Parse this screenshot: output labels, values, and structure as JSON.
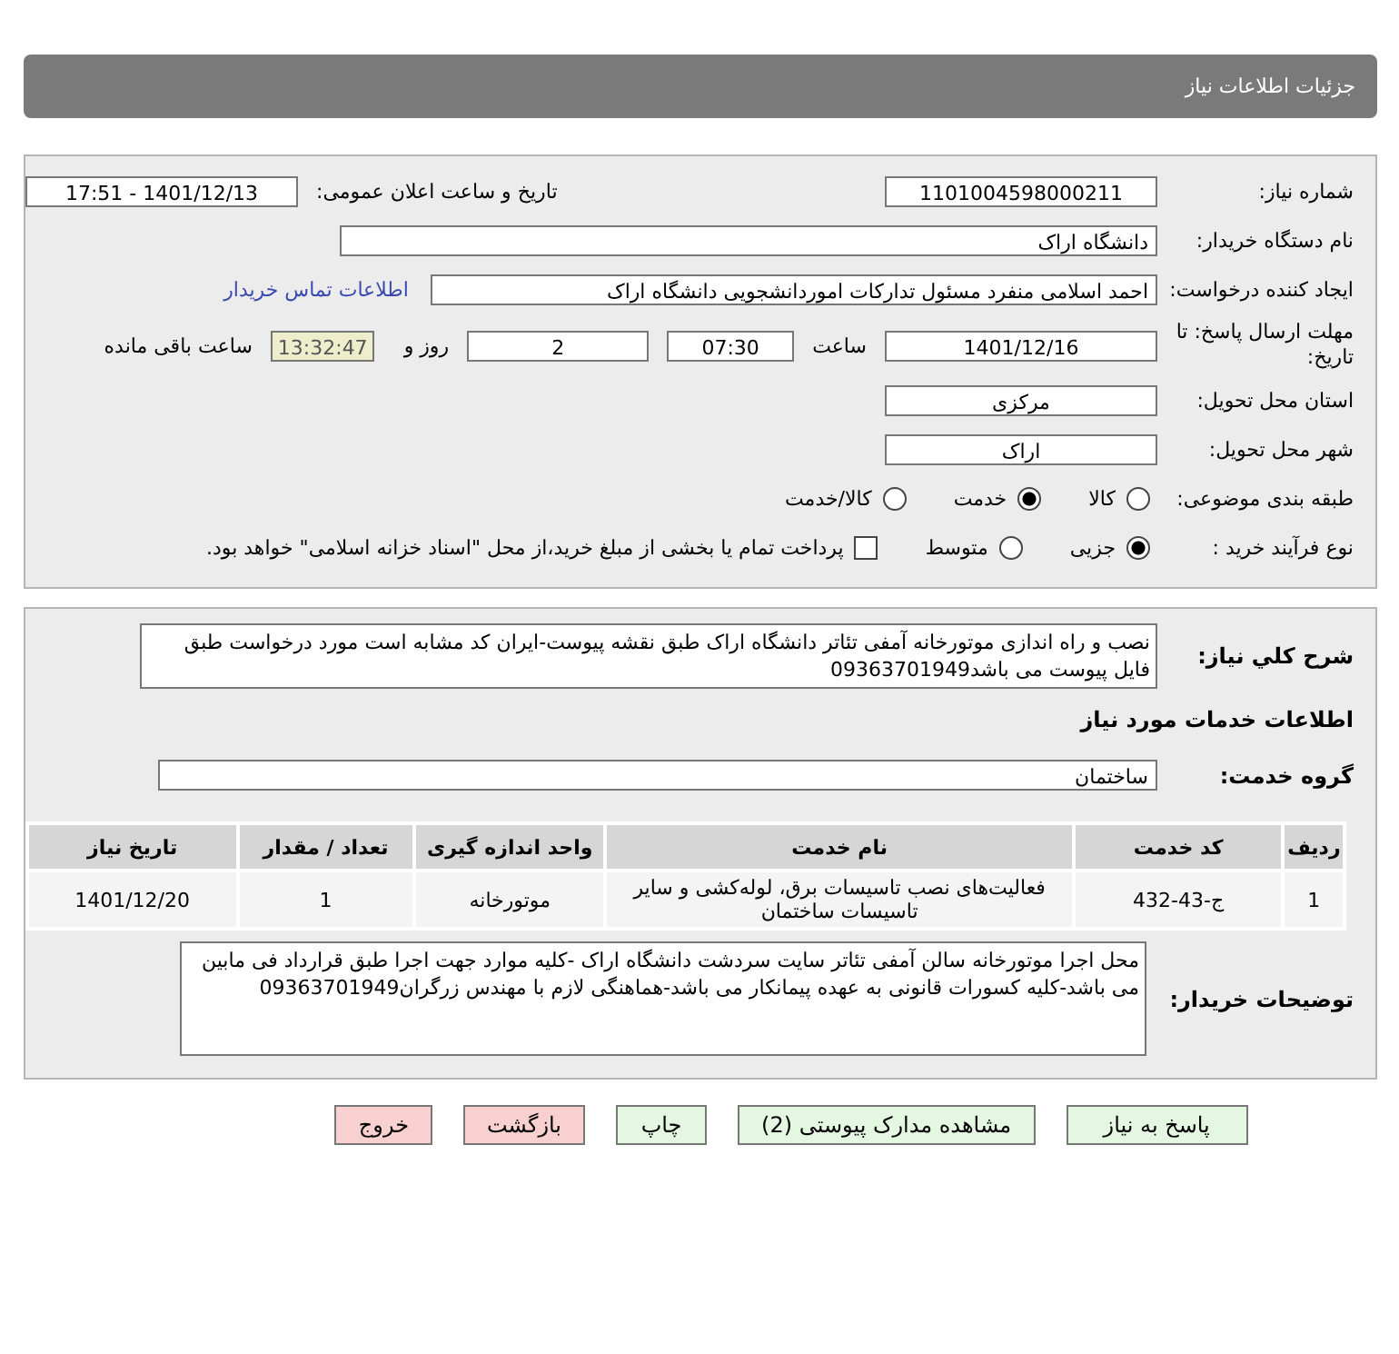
{
  "header": {
    "title": "جزئیات اطلاعات نیاز"
  },
  "need_info": {
    "need_number": {
      "label": "شماره نیاز:",
      "value": "1101004598000211"
    },
    "announce": {
      "label": "تاریخ و ساعت اعلان عمومی:",
      "value": "1401/12/13 - 17:51"
    },
    "buyer": {
      "label": "نام دستگاه خریدار:",
      "value": "دانشگاه اراک"
    },
    "requester": {
      "label": "ایجاد کننده درخواست:",
      "value": "احمد  اسلامی منفرد مسئول تدارکات اموردانشجویی دانشگاه اراک",
      "link": "اطلاعات تماس خریدار"
    },
    "deadline": {
      "label": "مهلت ارسال پاسخ: تا تاریخ:",
      "date": "1401/12/16",
      "time_label": "ساعت",
      "time": "07:30",
      "days": "2",
      "days_label": "روز و",
      "remaining": "13:32:47",
      "remaining_label": "ساعت باقی مانده"
    },
    "province": {
      "label": "استان محل تحویل:",
      "value": "مرکزی"
    },
    "city": {
      "label": "شهر محل تحویل:",
      "value": "اراک"
    },
    "category": {
      "label": "طبقه بندی موضوعی:",
      "options": [
        {
          "label": "کالا",
          "selected": false
        },
        {
          "label": "خدمت",
          "selected": true
        },
        {
          "label": "کالا/خدمت",
          "selected": false
        }
      ]
    },
    "process": {
      "label": "نوع فرآیند خرید :",
      "options": [
        {
          "label": "جزیی",
          "selected": true
        },
        {
          "label": "متوسط",
          "selected": false
        }
      ],
      "payment": {
        "checked": false,
        "text": "پرداخت تمام یا بخشی از مبلغ خرید،از محل \"اسناد خزانه اسلامی\" خواهد بود."
      }
    }
  },
  "details": {
    "summary": {
      "label": "شرح کلي نياز:",
      "value": "نصب و راه اندازی موتورخانه آمفی تئاتر دانشگاه اراک طبق نقشه پیوست-ایران کد مشابه است مورد درخواست طبق فایل پیوست می باشد09363701949"
    },
    "services_heading": "اطلاعات خدمات مورد نیاز",
    "service_group": {
      "label": "گروه خدمت:",
      "value": "ساختمان"
    },
    "table": {
      "columns": [
        "ردیف",
        "کد خدمت",
        "نام خدمت",
        "واحد اندازه گیری",
        "تعداد / مقدار",
        "تاریخ نیاز"
      ],
      "rows": [
        [
          "1",
          "ج-43-432",
          "فعالیت‌های نصب تاسیسات برق، لوله‌کشی و سایر تاسیسات ساختمان",
          "موتورخانه",
          "1",
          "1401/12/20"
        ]
      ]
    },
    "buyer_notes": {
      "label": "توضیحات خریدار:",
      "value": "محل اجرا موتورخانه سالن آمفی تئاتر سایت سردشت دانشگاه اراک -کلیه موارد جهت اجرا طبق قرارداد فی مابین می باشد-کلیه کسورات قانونی به عهده پیمانکار می باشد-هماهنگی لازم با مهندس زرگران09363701949"
    }
  },
  "buttons": [
    {
      "label": "پاسخ به نیاز",
      "kind": "green"
    },
    {
      "label": "مشاهده مدارک پیوستی (2)",
      "kind": "green"
    },
    {
      "label": "چاپ",
      "kind": "green"
    },
    {
      "label": "بازگشت",
      "kind": "pink"
    },
    {
      "label": "خروج",
      "kind": "pink"
    }
  ]
}
